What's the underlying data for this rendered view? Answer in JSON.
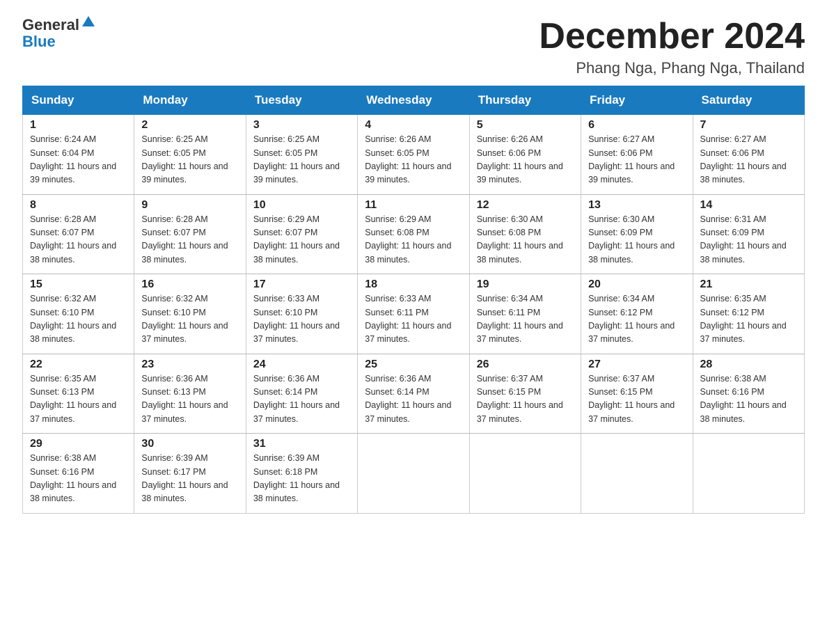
{
  "header": {
    "logo_general": "General",
    "logo_blue": "Blue",
    "month_title": "December 2024",
    "location": "Phang Nga, Phang Nga, Thailand"
  },
  "days_of_week": [
    "Sunday",
    "Monday",
    "Tuesday",
    "Wednesday",
    "Thursday",
    "Friday",
    "Saturday"
  ],
  "weeks": [
    [
      {
        "day": "1",
        "sunrise": "6:24 AM",
        "sunset": "6:04 PM",
        "daylight": "11 hours and 39 minutes."
      },
      {
        "day": "2",
        "sunrise": "6:25 AM",
        "sunset": "6:05 PM",
        "daylight": "11 hours and 39 minutes."
      },
      {
        "day": "3",
        "sunrise": "6:25 AM",
        "sunset": "6:05 PM",
        "daylight": "11 hours and 39 minutes."
      },
      {
        "day": "4",
        "sunrise": "6:26 AM",
        "sunset": "6:05 PM",
        "daylight": "11 hours and 39 minutes."
      },
      {
        "day": "5",
        "sunrise": "6:26 AM",
        "sunset": "6:06 PM",
        "daylight": "11 hours and 39 minutes."
      },
      {
        "day": "6",
        "sunrise": "6:27 AM",
        "sunset": "6:06 PM",
        "daylight": "11 hours and 39 minutes."
      },
      {
        "day": "7",
        "sunrise": "6:27 AM",
        "sunset": "6:06 PM",
        "daylight": "11 hours and 38 minutes."
      }
    ],
    [
      {
        "day": "8",
        "sunrise": "6:28 AM",
        "sunset": "6:07 PM",
        "daylight": "11 hours and 38 minutes."
      },
      {
        "day": "9",
        "sunrise": "6:28 AM",
        "sunset": "6:07 PM",
        "daylight": "11 hours and 38 minutes."
      },
      {
        "day": "10",
        "sunrise": "6:29 AM",
        "sunset": "6:07 PM",
        "daylight": "11 hours and 38 minutes."
      },
      {
        "day": "11",
        "sunrise": "6:29 AM",
        "sunset": "6:08 PM",
        "daylight": "11 hours and 38 minutes."
      },
      {
        "day": "12",
        "sunrise": "6:30 AM",
        "sunset": "6:08 PM",
        "daylight": "11 hours and 38 minutes."
      },
      {
        "day": "13",
        "sunrise": "6:30 AM",
        "sunset": "6:09 PM",
        "daylight": "11 hours and 38 minutes."
      },
      {
        "day": "14",
        "sunrise": "6:31 AM",
        "sunset": "6:09 PM",
        "daylight": "11 hours and 38 minutes."
      }
    ],
    [
      {
        "day": "15",
        "sunrise": "6:32 AM",
        "sunset": "6:10 PM",
        "daylight": "11 hours and 38 minutes."
      },
      {
        "day": "16",
        "sunrise": "6:32 AM",
        "sunset": "6:10 PM",
        "daylight": "11 hours and 37 minutes."
      },
      {
        "day": "17",
        "sunrise": "6:33 AM",
        "sunset": "6:10 PM",
        "daylight": "11 hours and 37 minutes."
      },
      {
        "day": "18",
        "sunrise": "6:33 AM",
        "sunset": "6:11 PM",
        "daylight": "11 hours and 37 minutes."
      },
      {
        "day": "19",
        "sunrise": "6:34 AM",
        "sunset": "6:11 PM",
        "daylight": "11 hours and 37 minutes."
      },
      {
        "day": "20",
        "sunrise": "6:34 AM",
        "sunset": "6:12 PM",
        "daylight": "11 hours and 37 minutes."
      },
      {
        "day": "21",
        "sunrise": "6:35 AM",
        "sunset": "6:12 PM",
        "daylight": "11 hours and 37 minutes."
      }
    ],
    [
      {
        "day": "22",
        "sunrise": "6:35 AM",
        "sunset": "6:13 PM",
        "daylight": "11 hours and 37 minutes."
      },
      {
        "day": "23",
        "sunrise": "6:36 AM",
        "sunset": "6:13 PM",
        "daylight": "11 hours and 37 minutes."
      },
      {
        "day": "24",
        "sunrise": "6:36 AM",
        "sunset": "6:14 PM",
        "daylight": "11 hours and 37 minutes."
      },
      {
        "day": "25",
        "sunrise": "6:36 AM",
        "sunset": "6:14 PM",
        "daylight": "11 hours and 37 minutes."
      },
      {
        "day": "26",
        "sunrise": "6:37 AM",
        "sunset": "6:15 PM",
        "daylight": "11 hours and 37 minutes."
      },
      {
        "day": "27",
        "sunrise": "6:37 AM",
        "sunset": "6:15 PM",
        "daylight": "11 hours and 37 minutes."
      },
      {
        "day": "28",
        "sunrise": "6:38 AM",
        "sunset": "6:16 PM",
        "daylight": "11 hours and 38 minutes."
      }
    ],
    [
      {
        "day": "29",
        "sunrise": "6:38 AM",
        "sunset": "6:16 PM",
        "daylight": "11 hours and 38 minutes."
      },
      {
        "day": "30",
        "sunrise": "6:39 AM",
        "sunset": "6:17 PM",
        "daylight": "11 hours and 38 minutes."
      },
      {
        "day": "31",
        "sunrise": "6:39 AM",
        "sunset": "6:18 PM",
        "daylight": "11 hours and 38 minutes."
      },
      null,
      null,
      null,
      null
    ]
  ]
}
